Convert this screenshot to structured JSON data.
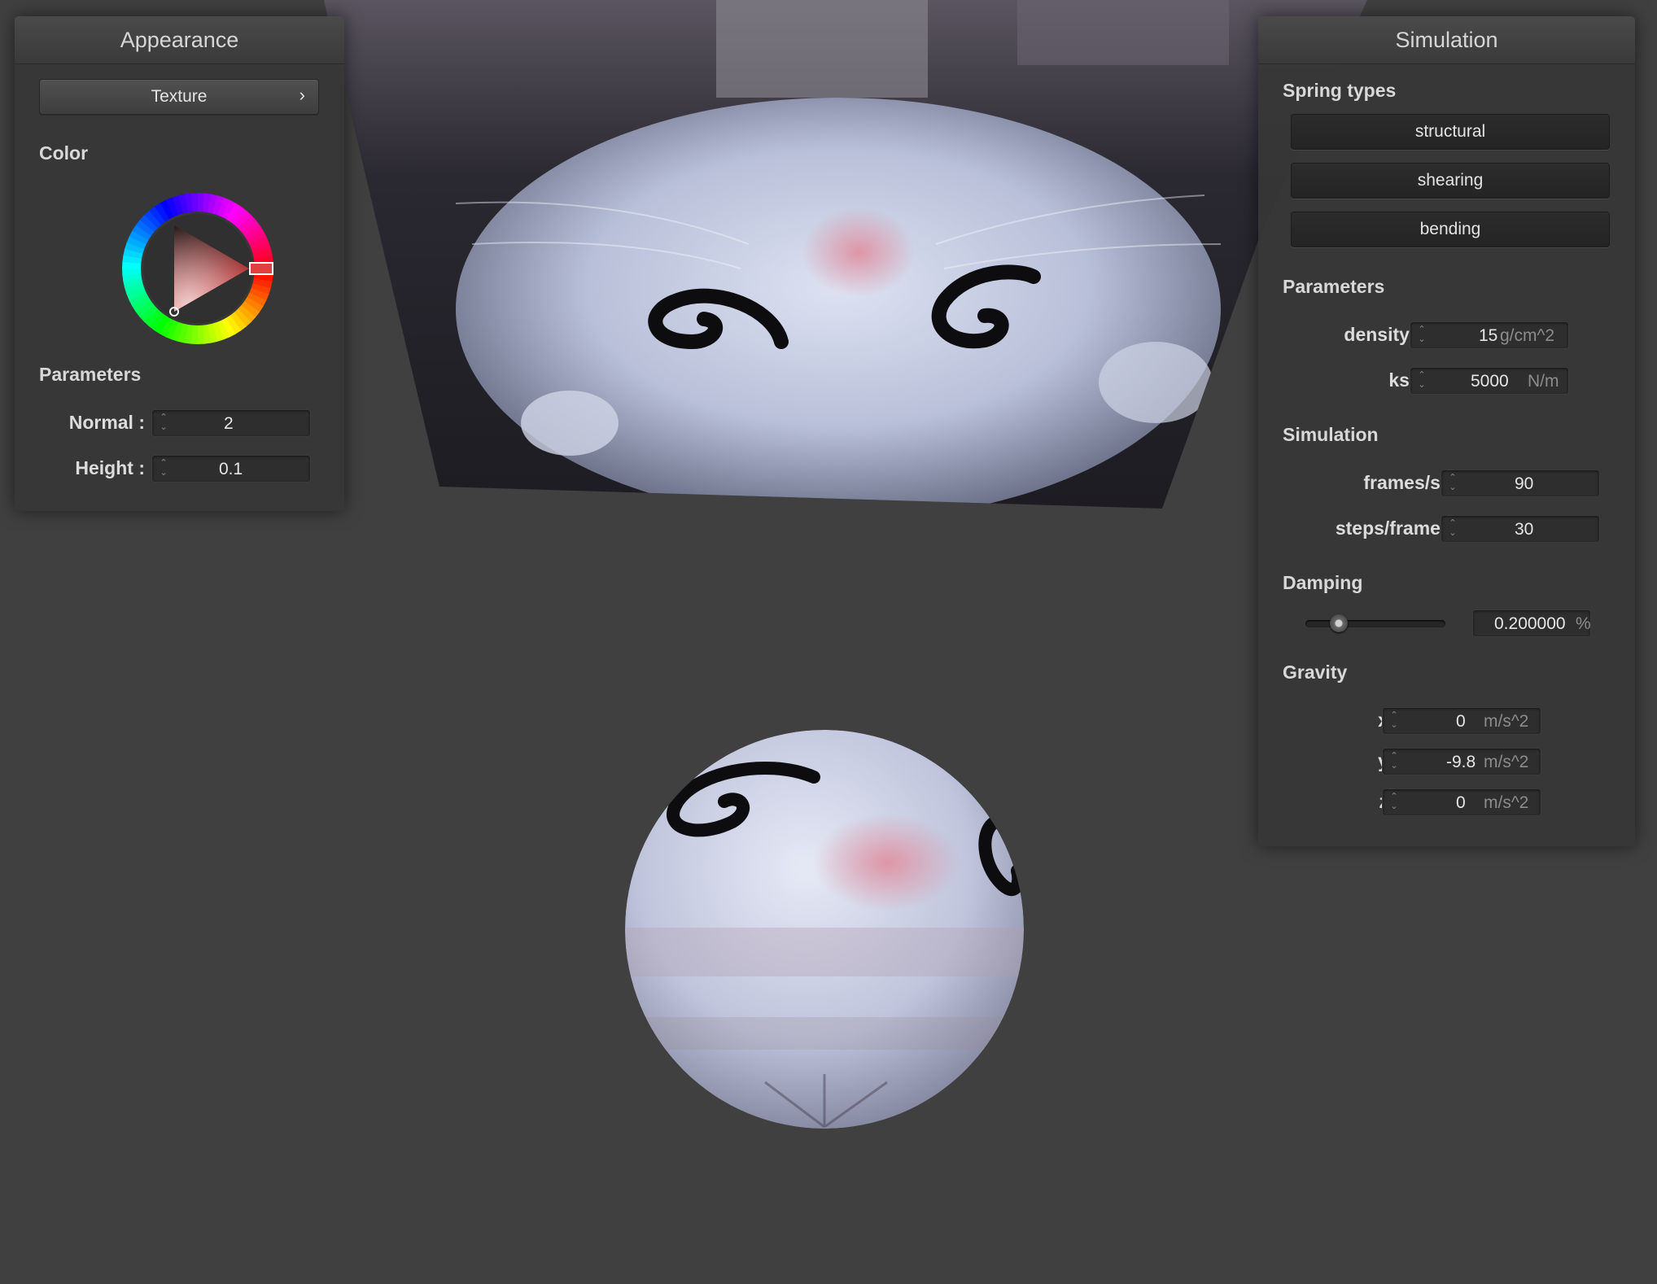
{
  "appearance": {
    "title": "Appearance",
    "texture_label": "Texture",
    "texture_chevron": "›",
    "color_label": "Color",
    "color_hex": "#dc1e1e",
    "parameters_label": "Parameters",
    "normal": {
      "label": "Normal :",
      "value": "2"
    },
    "height": {
      "label": "Height :",
      "value": "0.1"
    }
  },
  "simulation": {
    "title": "Simulation",
    "spring_types_label": "Spring types",
    "spring_buttons": [
      "structural",
      "shearing",
      "bending"
    ],
    "parameters_label": "Parameters",
    "density": {
      "label": "density :",
      "value": "15",
      "unit": "g/cm^2"
    },
    "ks": {
      "label": "ks :",
      "value": "5000",
      "unit": "N/m"
    },
    "simulation_label": "Simulation",
    "frames": {
      "label": "frames/s :",
      "value": "90"
    },
    "steps": {
      "label": "steps/frame :",
      "value": "30"
    },
    "damping_label": "Damping",
    "damping": {
      "value": "0.200000",
      "unit": "%",
      "slider_fraction": 0.2
    },
    "gravity_label": "Gravity",
    "gravity": {
      "x": {
        "label": "x :",
        "value": "0",
        "unit": "m/s^2"
      },
      "y": {
        "label": "y :",
        "value": "-9.8",
        "unit": "m/s^2"
      },
      "z": {
        "label": "z :",
        "value": "0",
        "unit": "m/s^2"
      }
    }
  },
  "icons": {
    "spin_arrows": "⌃⌄",
    "color_wheel": "color-wheel-icon"
  }
}
